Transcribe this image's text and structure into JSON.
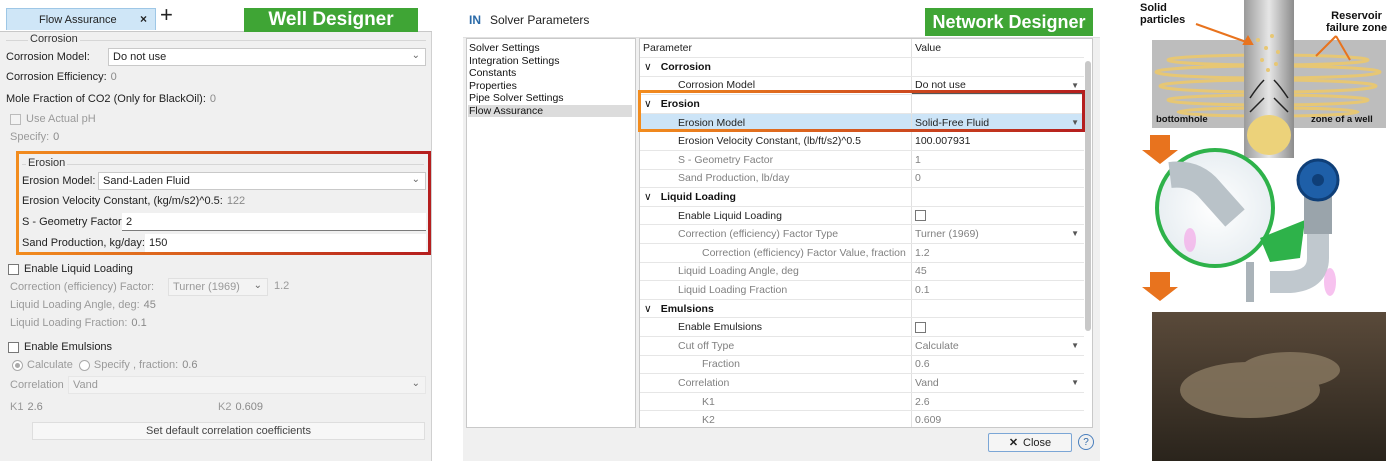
{
  "well_designer": {
    "tab_label": "Flow Assurance",
    "tab_close": "×",
    "add_tab": "+",
    "brand": "Well Designer",
    "corrosion": {
      "group_title": "Corrosion",
      "model_label": "Corrosion Model:",
      "model_value": "Do not use",
      "efficiency_label": "Corrosion Efficiency:",
      "efficiency_value": "0",
      "co2_label": "Mole Fraction of CO2 (Only for BlackOil):",
      "co2_value": "0",
      "use_ph_label": "Use Actual pH",
      "specify_label": "Specify:",
      "specify_value": "0"
    },
    "erosion": {
      "group_title": "Erosion",
      "model_label": "Erosion Model:",
      "model_value": "Sand-Laden Fluid",
      "velocity_label": "Erosion Velocity Constant, (kg/m/s2)^0.5:",
      "velocity_value": "122",
      "geometry_label": "S - Geometry Factor:",
      "geometry_value": "2",
      "sand_label": "Sand Production, kg/day:",
      "sand_value": "150"
    },
    "liquid_loading": {
      "enable_label": "Enable Liquid Loading",
      "correction_label": "Correction (efficiency) Factor:",
      "correction_value": "Turner (1969)",
      "correction_number": "1.2",
      "angle_label": "Liquid Loading Angle, deg:",
      "angle_value": "45",
      "fraction_label": "Liquid Loading Fraction:",
      "fraction_value": "0.1"
    },
    "emulsions": {
      "enable_label": "Enable Emulsions",
      "calculate_label": "Calculate",
      "specify_label": "Specify",
      "fraction_label": ", fraction:",
      "fraction_value": "0.6",
      "correlation_label": "Correlation",
      "correlation_value": "Vand",
      "k1_label": "K1",
      "k1_value": "2.6",
      "k2_label": "K2",
      "k2_value": "0.609",
      "default_button": "Set default correlation coefficients"
    },
    "colors": {
      "brand": "#3fa535",
      "highlight_start": "#f28c1e",
      "highlight_end": "#b51e1e"
    }
  },
  "network_designer": {
    "logo": "IN",
    "window_title": "Solver Parameters",
    "brand": "Network Designer",
    "nav_items": [
      "Solver Settings",
      "Integration Settings",
      "Constants",
      "Properties",
      "Pipe Solver Settings",
      "Flow Assurance"
    ],
    "selected_nav": "Flow Assurance",
    "grid_header": {
      "parameter": "Parameter",
      "value": "Value"
    },
    "rows": [
      {
        "kind": "cat",
        "label": "Corrosion"
      },
      {
        "kind": "prop",
        "label": "Corrosion Model",
        "value": "Do not use",
        "dropdown": true,
        "indent": 1
      },
      {
        "kind": "cat",
        "label": "Erosion"
      },
      {
        "kind": "prop",
        "label": "Erosion Model",
        "value": "Solid-Free Fluid",
        "dropdown": true,
        "indent": 1,
        "selected": true
      },
      {
        "kind": "prop",
        "label": "Erosion Velocity Constant, (lb/ft/s2)^0.5",
        "value": "100.007931",
        "indent": 1
      },
      {
        "kind": "prop",
        "label": "S - Geometry Factor",
        "value": "1",
        "indent": 1,
        "dim": true
      },
      {
        "kind": "prop",
        "label": "Sand Production, lb/day",
        "value": "0",
        "indent": 1,
        "dim": true
      },
      {
        "kind": "cat",
        "label": "Liquid Loading"
      },
      {
        "kind": "check",
        "label": "Enable Liquid Loading",
        "indent": 1
      },
      {
        "kind": "prop",
        "label": "Correction (efficiency) Factor Type",
        "value": "Turner (1969)",
        "dropdown": true,
        "indent": 1,
        "dim": true
      },
      {
        "kind": "prop",
        "label": "Correction (efficiency) Factor Value, fraction",
        "value": "1.2",
        "indent": 2,
        "dim": true
      },
      {
        "kind": "prop",
        "label": "Liquid Loading Angle, deg",
        "value": "45",
        "indent": 1,
        "dim": true
      },
      {
        "kind": "prop",
        "label": "Liquid Loading Fraction",
        "value": "0.1",
        "indent": 1,
        "dim": true
      },
      {
        "kind": "cat",
        "label": "Emulsions"
      },
      {
        "kind": "check",
        "label": "Enable Emulsions",
        "indent": 1
      },
      {
        "kind": "prop",
        "label": "Cut off Type",
        "value": "Calculate",
        "dropdown": true,
        "indent": 1,
        "dim": true
      },
      {
        "kind": "prop",
        "label": "Fraction",
        "value": "0.6",
        "indent": 2,
        "dim": true
      },
      {
        "kind": "prop",
        "label": "Correlation",
        "value": "Vand",
        "dropdown": true,
        "indent": 1,
        "dim": true
      },
      {
        "kind": "prop",
        "label": "K1",
        "value": "2.6",
        "indent": 2,
        "dim": true
      },
      {
        "kind": "prop",
        "label": "K2",
        "value": "0.609",
        "indent": 2,
        "dim": true
      }
    ],
    "close_button": "Close",
    "help_button": "?"
  },
  "illustration": {
    "solid_particles": "Solid\nparticles",
    "reservoir_failure": "Reservoir\nfailure zone",
    "bottomhole": "bottomhole",
    "zone_of_well": "zone of a well",
    "colors": {
      "arrow": "#e8731e",
      "highlight": "#2eb24a"
    }
  }
}
